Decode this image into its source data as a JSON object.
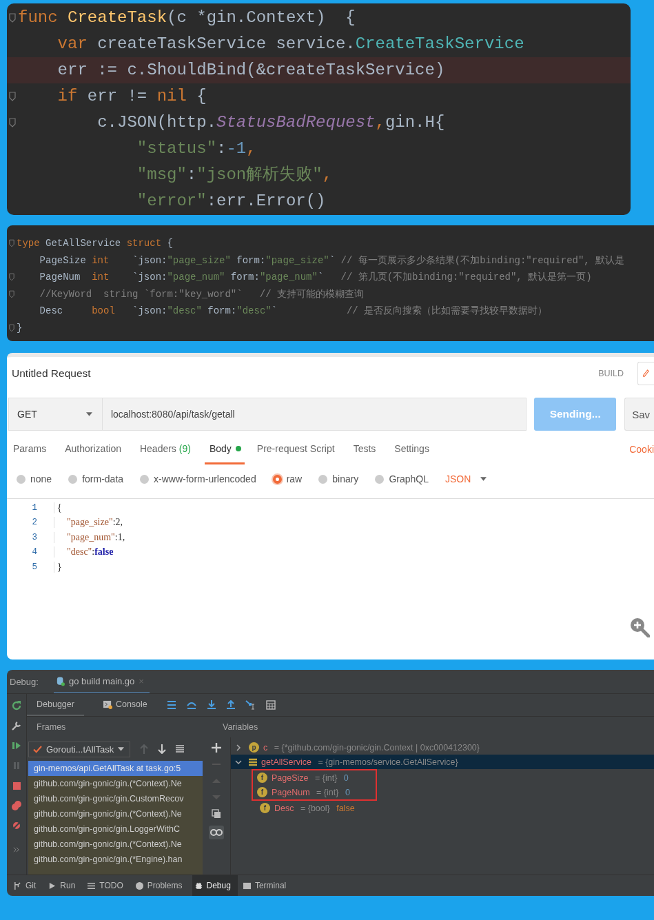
{
  "code_editor": {
    "lines": [
      {
        "highlighted": false,
        "fold": true,
        "tokens": [
          {
            "kind": "kw",
            "text": "func "
          },
          {
            "kind": "fn",
            "text": "CreateTask"
          },
          {
            "kind": "plain",
            "text": "(c *gin.Context)  {"
          }
        ]
      },
      {
        "highlighted": false,
        "fold": false,
        "tokens": [
          {
            "kind": "kw",
            "text": "    var "
          },
          {
            "kind": "plain",
            "text": "createTaskService service."
          },
          {
            "kind": "type",
            "text": "CreateTaskService"
          }
        ]
      },
      {
        "highlighted": true,
        "fold": false,
        "tokens": [
          {
            "kind": "plain",
            "text": "    err := c.ShouldBind(&createTaskService)"
          }
        ]
      },
      {
        "highlighted": false,
        "fold": true,
        "tokens": [
          {
            "kind": "kw",
            "text": "    if "
          },
          {
            "kind": "plain",
            "text": "err != "
          },
          {
            "kind": "kw",
            "text": "nil"
          },
          {
            "kind": "plain",
            "text": " {"
          }
        ]
      },
      {
        "highlighted": false,
        "fold": true,
        "tokens": [
          {
            "kind": "plain",
            "text": "        c.JSON(http."
          },
          {
            "kind": "field",
            "text": "StatusBadRequest"
          },
          {
            "kind": "kw",
            "text": ","
          },
          {
            "kind": "plain",
            "text": "gin.H{"
          }
        ]
      },
      {
        "highlighted": false,
        "fold": false,
        "tokens": [
          {
            "kind": "str",
            "text": "            \"status\""
          },
          {
            "kind": "plain",
            "text": ":"
          },
          {
            "kind": "num",
            "text": "-1"
          },
          {
            "kind": "kw",
            "text": ","
          }
        ]
      },
      {
        "highlighted": false,
        "fold": false,
        "tokens": [
          {
            "kind": "str",
            "text": "            \"msg\""
          },
          {
            "kind": "plain",
            "text": ":"
          },
          {
            "kind": "str",
            "text": "\"json解析失败\""
          },
          {
            "kind": "kw",
            "text": ","
          }
        ]
      },
      {
        "highlighted": false,
        "fold": false,
        "tokens": [
          {
            "kind": "str",
            "text": "            \"error\""
          },
          {
            "kind": "plain",
            "text": ":err.Error()"
          }
        ]
      }
    ]
  },
  "struct_editor": {
    "lines": [
      {
        "fold": true,
        "tokens": [
          {
            "kind": "kw",
            "text": "type"
          },
          {
            "kind": "plain",
            "text": " GetAllService "
          },
          {
            "kind": "kw",
            "text": "struct"
          },
          {
            "kind": "plain",
            "text": " {"
          }
        ]
      },
      {
        "fold": false,
        "tokens": [
          {
            "kind": "plain",
            "text": "    PageSize "
          },
          {
            "kind": "kw",
            "text": "int"
          },
          {
            "kind": "plain",
            "text": "    `json:"
          },
          {
            "kind": "str",
            "text": "\"page_size\""
          },
          {
            "kind": "plain",
            "text": " form:"
          },
          {
            "kind": "str",
            "text": "\"page_size\""
          },
          {
            "kind": "plain",
            "text": "` "
          },
          {
            "kind": "comment",
            "text": "// 每一页展示多少条结果(不加binding:\"required\", 默认是"
          }
        ]
      },
      {
        "fold": true,
        "tokens": [
          {
            "kind": "plain",
            "text": "    PageNum  "
          },
          {
            "kind": "kw",
            "text": "int"
          },
          {
            "kind": "plain",
            "text": "    `json:"
          },
          {
            "kind": "str",
            "text": "\"page_num\""
          },
          {
            "kind": "plain",
            "text": " form:"
          },
          {
            "kind": "str",
            "text": "\"page_num\""
          },
          {
            "kind": "plain",
            "text": "`   "
          },
          {
            "kind": "comment",
            "text": "// 第几页(不加binding:\"required\", 默认是第一页)"
          }
        ]
      },
      {
        "fold": true,
        "tokens": [
          {
            "kind": "comment",
            "text": "    //KeyWord  string `form:\"key_word\"`   // 支持可能的模糊查询"
          }
        ]
      },
      {
        "fold": false,
        "tokens": [
          {
            "kind": "plain",
            "text": "    Desc     "
          },
          {
            "kind": "kw",
            "text": "bool"
          },
          {
            "kind": "plain",
            "text": "   `json:"
          },
          {
            "kind": "str",
            "text": "\"desc\""
          },
          {
            "kind": "plain",
            "text": " form:"
          },
          {
            "kind": "str",
            "text": "\"desc\""
          },
          {
            "kind": "plain",
            "text": "`            "
          },
          {
            "kind": "comment",
            "text": "// 是否反向搜索（比如需要寻找较早数据时）"
          }
        ]
      },
      {
        "fold": true,
        "tokens": [
          {
            "kind": "plain",
            "text": "}"
          }
        ]
      }
    ]
  },
  "request": {
    "title": "Untitled Request",
    "build_label": "BUILD",
    "method": "GET",
    "url": "localhost:8080/api/task/getall",
    "send_button": "Sending...",
    "save_button": "Sav",
    "tabs": [
      {
        "label": "Params",
        "selected": false
      },
      {
        "label": "Authorization",
        "selected": false
      },
      {
        "label": "Headers",
        "count": "(9)",
        "selected": false
      },
      {
        "label": "Body",
        "dot": true,
        "selected": true
      },
      {
        "label": "Pre-request Script",
        "selected": false
      },
      {
        "label": "Tests",
        "selected": false
      },
      {
        "label": "Settings",
        "selected": false
      }
    ],
    "cookies_link": "Cooki",
    "body_types": [
      {
        "label": "none",
        "selected": false
      },
      {
        "label": "form-data",
        "selected": false
      },
      {
        "label": "x-www-form-urlencoded",
        "selected": false
      },
      {
        "label": "raw",
        "selected": true
      },
      {
        "label": "binary",
        "selected": false
      },
      {
        "label": "GraphQL",
        "selected": false
      }
    ],
    "format": "JSON",
    "body_lines": [
      {
        "number": "1",
        "tokens": [
          {
            "kind": "punct",
            "text": "{"
          }
        ]
      },
      {
        "number": "2",
        "tokens": [
          {
            "kind": "key",
            "text": "    \"page_size\""
          },
          {
            "kind": "punct",
            "text": ":2,"
          }
        ]
      },
      {
        "number": "3",
        "tokens": [
          {
            "kind": "key",
            "text": "    \"page_num\""
          },
          {
            "kind": "punct",
            "text": ":1,"
          }
        ]
      },
      {
        "number": "4",
        "tokens": [
          {
            "kind": "key",
            "text": "    \"desc\""
          },
          {
            "kind": "punct",
            "text": ":"
          },
          {
            "kind": "bool",
            "text": "false"
          }
        ]
      },
      {
        "number": "5",
        "tokens": [
          {
            "kind": "punct",
            "text": "}"
          }
        ]
      }
    ]
  },
  "debug": {
    "label": "Debug:",
    "session": "go build main.go",
    "close": "×",
    "tabs": [
      {
        "label": "Debugger",
        "selected": true
      },
      {
        "label": "Console",
        "selected": false
      }
    ],
    "frames_header": "Frames",
    "variables_header": "Variables",
    "goroutine": "Gorouti...tAllTask",
    "frames": [
      {
        "text": "gin-memos/api.GetAllTask at task.go:5",
        "selected": true
      },
      {
        "text": "github.com/gin-gonic/gin.(*Context).Ne",
        "selected": false
      },
      {
        "text": "github.com/gin-gonic/gin.CustomRecov",
        "selected": false
      },
      {
        "text": "github.com/gin-gonic/gin.(*Context).Ne",
        "selected": false
      },
      {
        "text": "github.com/gin-gonic/gin.LoggerWithC",
        "selected": false
      },
      {
        "text": "github.com/gin-gonic/gin.(*Context).Ne",
        "selected": false
      },
      {
        "text": "github.com/gin-gonic/gin.(*Engine).han",
        "selected": false
      }
    ],
    "variables": [
      {
        "kind": "param",
        "badge": "p",
        "name": "c",
        "type": "= {*github.com/gin-gonic/gin.Context | 0xc000412300}",
        "expanded": false,
        "selected": false
      },
      {
        "kind": "struct",
        "name": "getAllService",
        "type": "= {gin-memos/service.GetAllService}",
        "expanded": true,
        "selected": true,
        "children": [
          {
            "kind": "number",
            "badge": "f",
            "name": "PageSize",
            "type": "= {int}",
            "value": "0",
            "boxed": true
          },
          {
            "kind": "number",
            "badge": "f",
            "name": "PageNum",
            "type": "= {int}",
            "value": "0",
            "boxed": true
          },
          {
            "kind": "bool",
            "badge": "f",
            "name": "Desc",
            "type": "= {bool}",
            "value": "false",
            "boxed": false
          }
        ]
      }
    ],
    "bottom_tabs": [
      {
        "kind": "git",
        "label": "Git",
        "selected": false
      },
      {
        "kind": "run",
        "label": "Run",
        "selected": false
      },
      {
        "kind": "todo",
        "label": "TODO",
        "selected": false
      },
      {
        "kind": "problems",
        "label": "Problems",
        "selected": false
      },
      {
        "kind": "debug",
        "label": "Debug",
        "selected": true
      },
      {
        "kind": "terminal",
        "label": "Terminal",
        "selected": false
      }
    ]
  }
}
